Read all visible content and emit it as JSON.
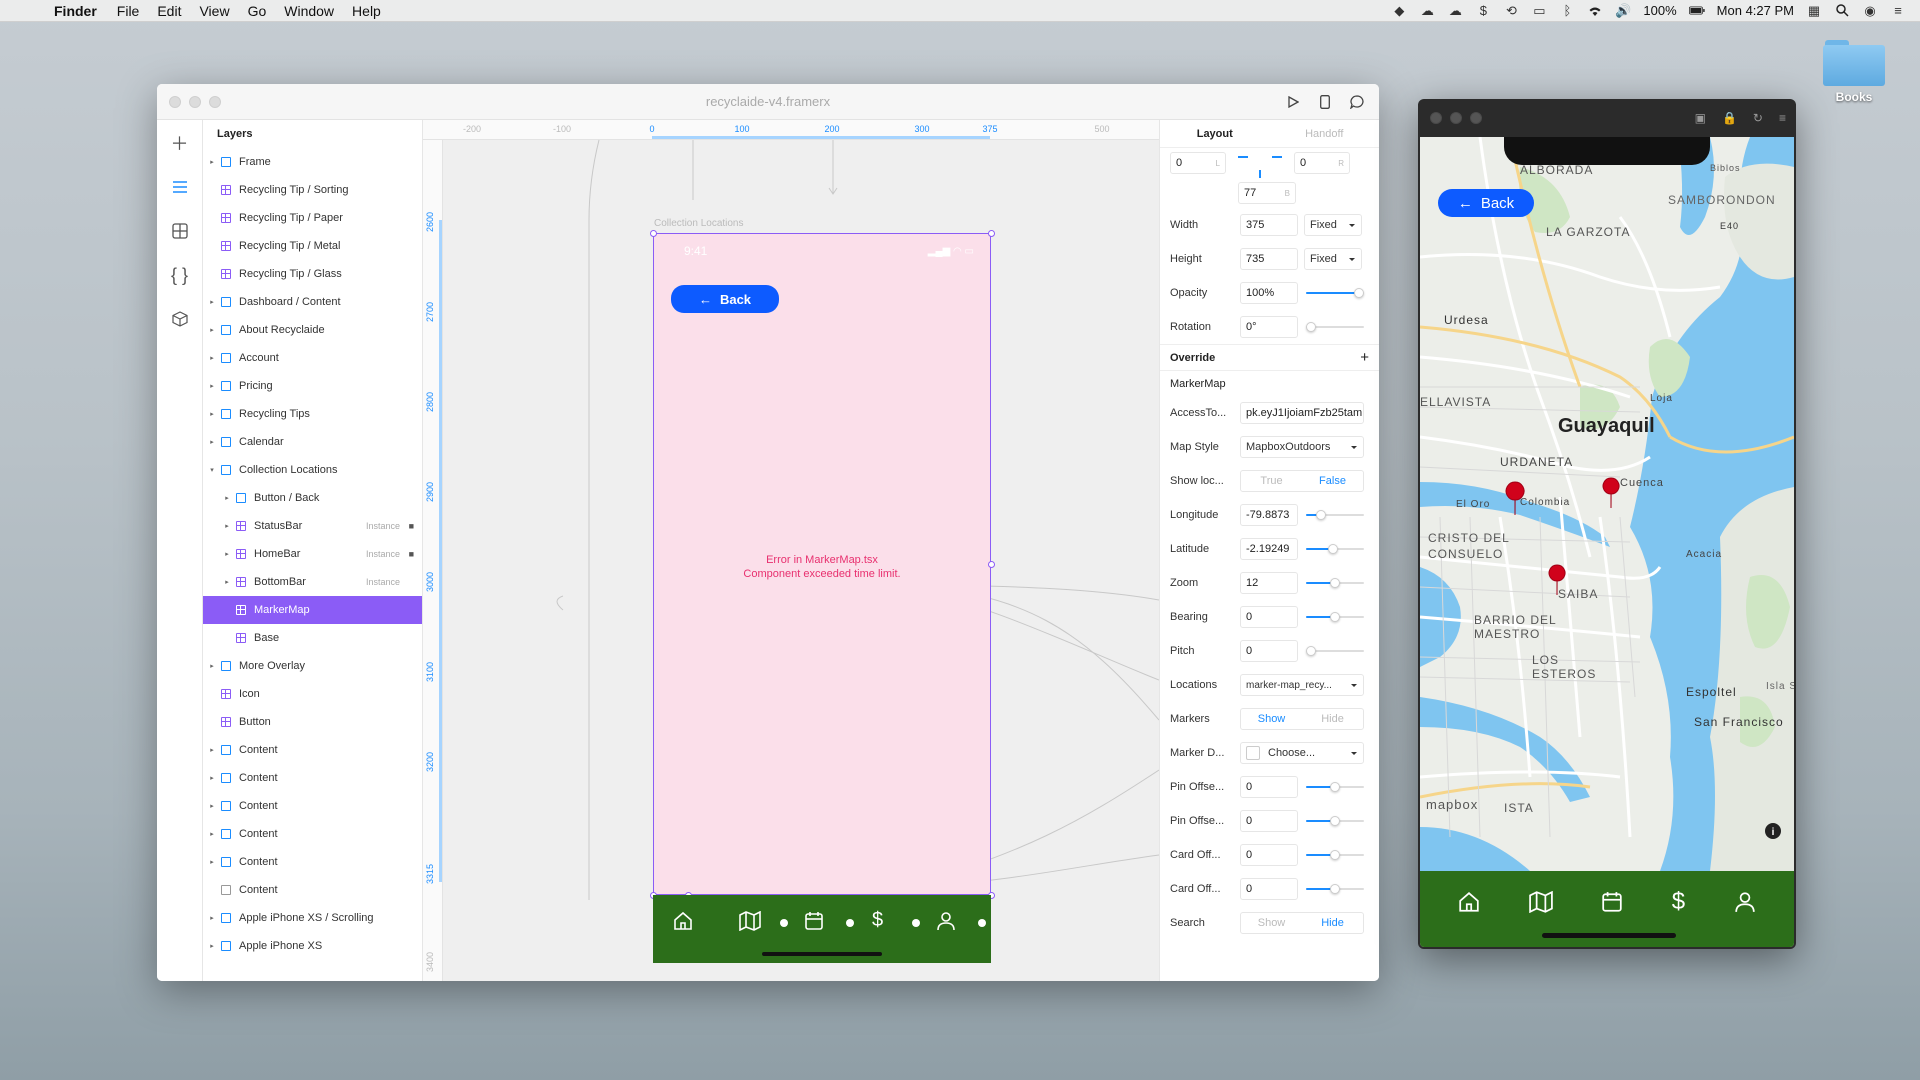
{
  "menubar": {
    "app": "Finder",
    "items": [
      "File",
      "Edit",
      "View",
      "Go",
      "Window",
      "Help"
    ],
    "battery": "100%",
    "clock": "Mon 4:27 PM"
  },
  "desktop": {
    "folder_label": "Books"
  },
  "framer": {
    "title": "recyclaide-v4.framerx",
    "layers_title": "Layers",
    "layers": [
      {
        "label": "Frame",
        "type": "frame",
        "arrow": "▸",
        "indent": 0
      },
      {
        "label": "Recycling Tip / Sorting",
        "type": "component",
        "arrow": "",
        "indent": 0
      },
      {
        "label": "Recycling Tip / Paper",
        "type": "component",
        "arrow": "",
        "indent": 0
      },
      {
        "label": "Recycling Tip / Metal",
        "type": "component",
        "arrow": "",
        "indent": 0
      },
      {
        "label": "Recycling Tip / Glass",
        "type": "component",
        "arrow": "",
        "indent": 0
      },
      {
        "label": "Dashboard / Content",
        "type": "frame",
        "arrow": "▸",
        "indent": 0
      },
      {
        "label": "About Recyclaide",
        "type": "frame",
        "arrow": "▸",
        "indent": 0
      },
      {
        "label": "Account",
        "type": "frame",
        "arrow": "▸",
        "indent": 0
      },
      {
        "label": "Pricing",
        "type": "frame",
        "arrow": "▸",
        "indent": 0
      },
      {
        "label": "Recycling Tips",
        "type": "frame",
        "arrow": "▸",
        "indent": 0
      },
      {
        "label": "Calendar",
        "type": "frame",
        "arrow": "▸",
        "indent": 0
      },
      {
        "label": "Collection Locations",
        "type": "frame",
        "arrow": "▾",
        "indent": 0
      },
      {
        "label": "Button / Back",
        "type": "frame",
        "arrow": "▸",
        "indent": 1
      },
      {
        "label": "StatusBar",
        "type": "component",
        "arrow": "▸",
        "indent": 1,
        "tag": "Instance",
        "lock": true
      },
      {
        "label": "HomeBar",
        "type": "component",
        "arrow": "▸",
        "indent": 1,
        "tag": "Instance",
        "lock": true
      },
      {
        "label": "BottomBar",
        "type": "component",
        "arrow": "▸",
        "indent": 1,
        "tag": "Instance"
      },
      {
        "label": "MarkerMap",
        "type": "component",
        "arrow": "",
        "indent": 1,
        "selected": true
      },
      {
        "label": "Base",
        "type": "component",
        "arrow": "",
        "indent": 1
      },
      {
        "label": "More Overlay",
        "type": "frame",
        "arrow": "▸",
        "indent": 0
      },
      {
        "label": "Icon",
        "type": "component",
        "arrow": "",
        "indent": 0
      },
      {
        "label": "Button",
        "type": "component",
        "arrow": "",
        "indent": 0
      },
      {
        "label": "Content",
        "type": "frame",
        "arrow": "▸",
        "indent": 0
      },
      {
        "label": "Content",
        "type": "frame",
        "arrow": "▸",
        "indent": 0
      },
      {
        "label": "Content",
        "type": "frame",
        "arrow": "▸",
        "indent": 0
      },
      {
        "label": "Content",
        "type": "frame",
        "arrow": "▸",
        "indent": 0
      },
      {
        "label": "Content",
        "type": "frame",
        "arrow": "▸",
        "indent": 0
      },
      {
        "label": "Content",
        "type": "plain",
        "arrow": "",
        "indent": 0
      },
      {
        "label": "Apple iPhone XS / Scrolling",
        "type": "frame",
        "arrow": "▸",
        "indent": 0
      },
      {
        "label": "Apple iPhone XS",
        "type": "frame",
        "arrow": "▸",
        "indent": 0
      }
    ],
    "ruler_top": [
      "-200",
      "-100",
      "0",
      "100",
      "200",
      "300",
      "375",
      "500"
    ],
    "ruler_left": [
      "2600",
      "2700",
      "2800",
      "2900",
      "3000",
      "3100",
      "3200",
      "3315",
      "3400"
    ],
    "canvas": {
      "frame_label": "Collection Locations",
      "status_time": "9:41",
      "back_label": "Back",
      "error_title": "Error in MarkerMap.tsx",
      "error_detail": "Component exceeded time limit."
    },
    "props": {
      "tab_layout": "Layout",
      "tab_handoff": "Handoff",
      "left": "0",
      "left_unit": "L",
      "right": "0",
      "right_unit": "R",
      "bottom": "77",
      "bottom_unit": "B",
      "width_label": "Width",
      "width": "375",
      "width_mode": "Fixed",
      "height_label": "Height",
      "height": "735",
      "height_mode": "Fixed",
      "opacity_label": "Opacity",
      "opacity": "100%",
      "rotation_label": "Rotation",
      "rotation": "0°",
      "override_label": "Override",
      "component_name": "MarkerMap",
      "access_label": "AccessTo...",
      "access_value": "pk.eyJ1IjoiamFzb25tam",
      "mapstyle_label": "Map Style",
      "mapstyle_value": "MapboxOutdoors",
      "showloc_label": "Show loc...",
      "true_label": "True",
      "false_label": "False",
      "longitude_label": "Longitude",
      "longitude": "-79.8873",
      "latitude_label": "Latitude",
      "latitude": "-2.19249",
      "zoom_label": "Zoom",
      "zoom": "12",
      "bearing_label": "Bearing",
      "bearing": "0",
      "pitch_label": "Pitch",
      "pitch": "0",
      "locations_label": "Locations",
      "locations_value": "marker-map_recy...",
      "markers_label": "Markers",
      "show_label": "Show",
      "hide_label": "Hide",
      "markerd_label": "Marker D...",
      "markerd_value": "Choose...",
      "pinx_label": "Pin Offse...",
      "pinx": "0",
      "piny_label": "Pin Offse...",
      "piny": "0",
      "cardx_label": "Card Off...",
      "cardx": "0",
      "cardy_label": "Card Off...",
      "cardy": "0",
      "search_label": "Search"
    }
  },
  "preview": {
    "back_label": "Back",
    "map_labels": [
      "ALBORADA",
      "SAMBORONDON",
      "LA GARZOTA",
      "Urdesa",
      "Guayaquil",
      "URDANETA",
      "Cuenca",
      "Colombia",
      "El Oro",
      "CRISTO DEL",
      "CONSUELO",
      "SAIBA",
      "BARRIO DEL",
      "MAESTRO",
      "LOS",
      "ESTEROS",
      "Acacia",
      "Espoltel",
      "San Francisco",
      "Isla Sa",
      "ELLAVISTA",
      "Loja",
      "E40",
      "Biblos",
      "mapbox",
      "ISTA"
    ]
  },
  "colors": {
    "accent": "#1a8cff",
    "selection": "#8b5cf6",
    "bottom_bar": "#2c6e1a",
    "back_button": "#0d5bff",
    "error_text": "#e8306f",
    "marker": "#d0021b",
    "water": "#7fc5f0"
  }
}
